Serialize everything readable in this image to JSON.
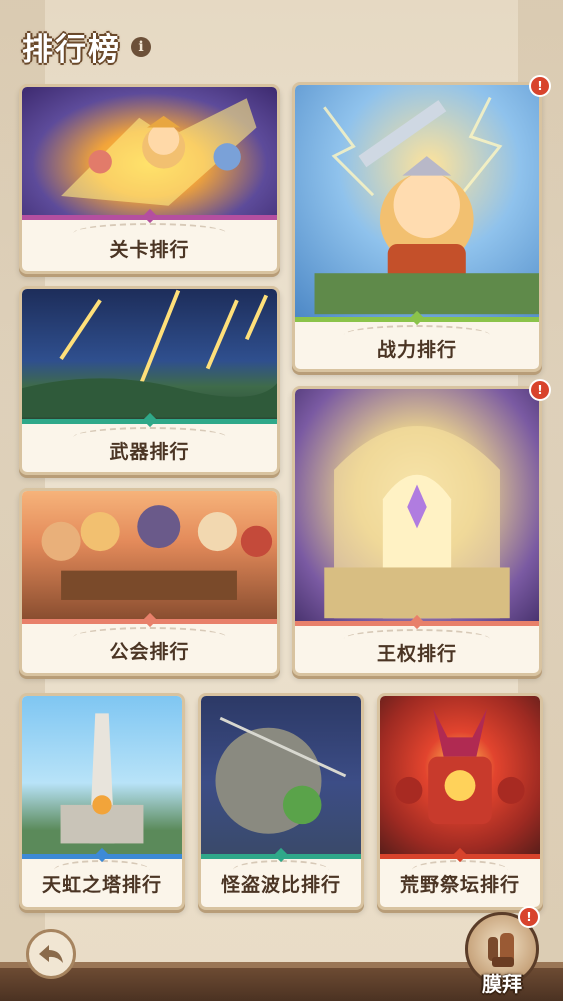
{
  "header": {
    "title": "排行榜",
    "info_icon": "info-icon"
  },
  "cards": {
    "stage": {
      "label": "关卡排行",
      "accent": "#b44fa0",
      "alert": false
    },
    "power": {
      "label": "战力排行",
      "accent": "#8bc34a",
      "alert": true,
      "alert_text": "!"
    },
    "weapon": {
      "label": "武器排行",
      "accent": "#2fa889",
      "alert": false
    },
    "throne": {
      "label": "王权排行",
      "accent": "#e8806a",
      "alert": true,
      "alert_text": "!"
    },
    "guild": {
      "label": "公会排行",
      "accent": "#e8806a",
      "alert": false
    },
    "tower": {
      "label": "天虹之塔排行",
      "accent": "#3d8ad6",
      "alert": false
    },
    "thief": {
      "label": "怪盗波比排行",
      "accent": "#2fa889",
      "alert": false
    },
    "wild": {
      "label": "荒野祭坛排行",
      "accent": "#d8432c",
      "alert": false
    }
  },
  "footer": {
    "back_icon": "back-arrow-icon",
    "worship_label": "膜拜",
    "worship_icon": "worship-icon",
    "worship_alert": "!"
  }
}
